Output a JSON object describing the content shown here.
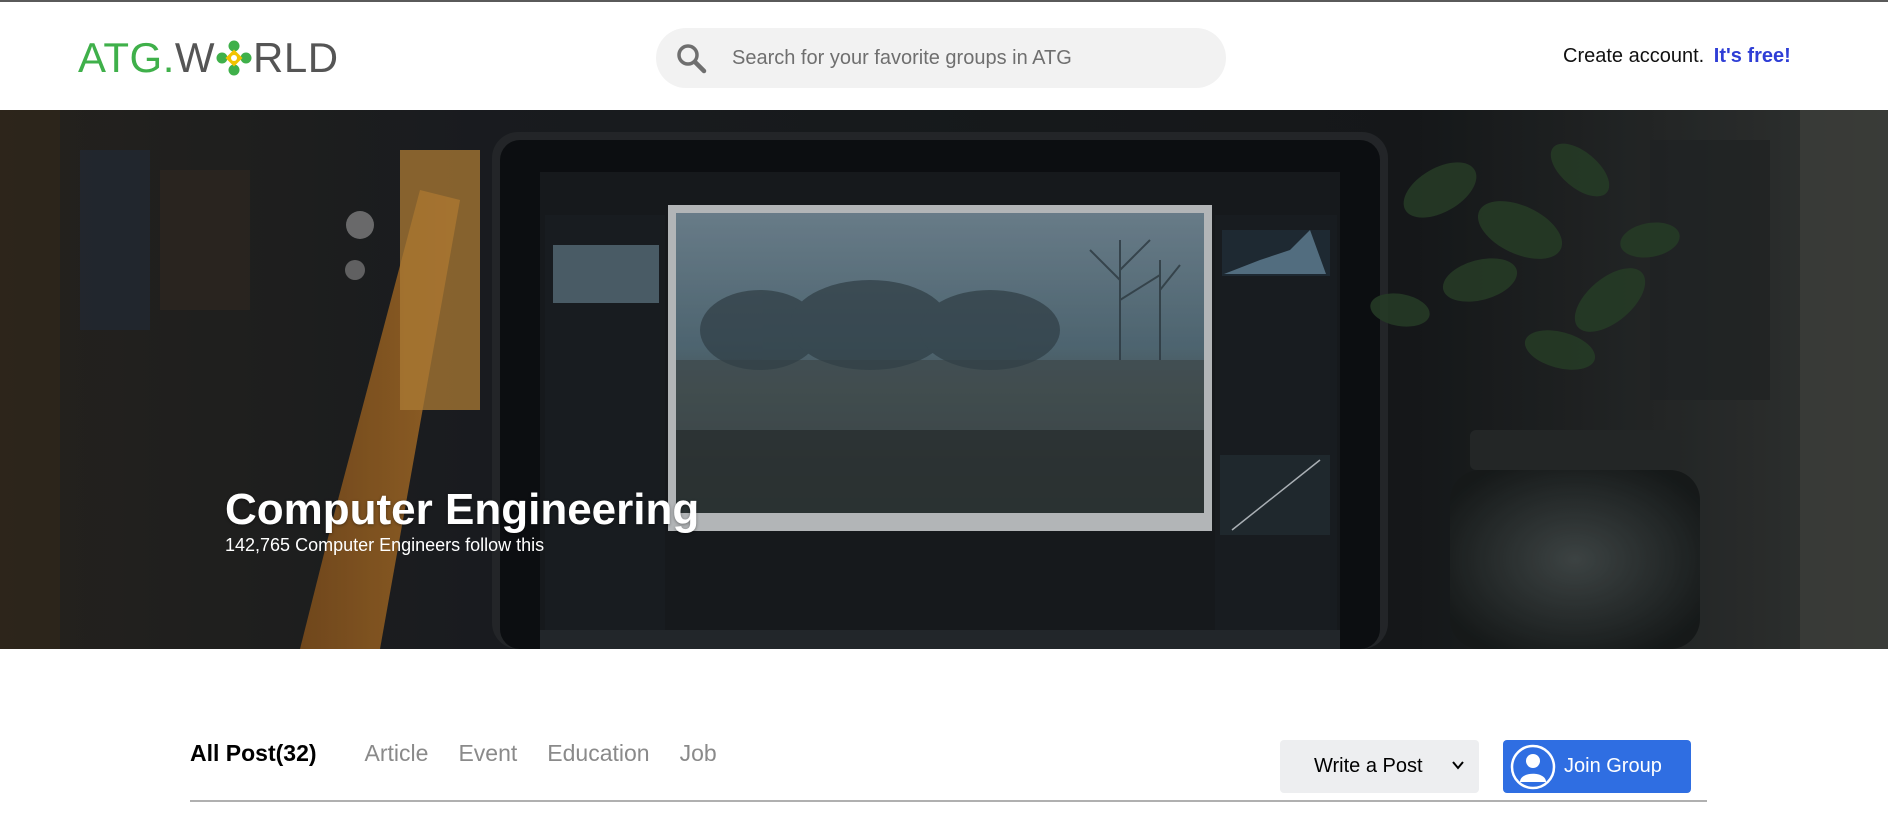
{
  "header": {
    "logo": {
      "part1": "ATG.",
      "part2": "W",
      "part3": "RLD"
    },
    "search_placeholder": "Search for your favorite groups in ATG",
    "create_account": "Create account.",
    "free_label": "It's free!"
  },
  "hero": {
    "title": "Computer Engineering",
    "followers": "142,765 Computer Engineers follow this"
  },
  "tabs": [
    {
      "label": "All Post(32)",
      "active": true
    },
    {
      "label": "Article"
    },
    {
      "label": "Event"
    },
    {
      "label": "Education"
    },
    {
      "label": "Job"
    }
  ],
  "actions": {
    "write_post": "Write a Post",
    "join_group": "Join Group"
  },
  "colors": {
    "brand_green": "#3fb04a",
    "link_blue": "#2f3ed6",
    "join_blue": "#2f6ee2"
  },
  "icons": [
    "search-icon",
    "chevron-down-icon",
    "user-avatar-icon",
    "logo-mark-icon"
  ]
}
